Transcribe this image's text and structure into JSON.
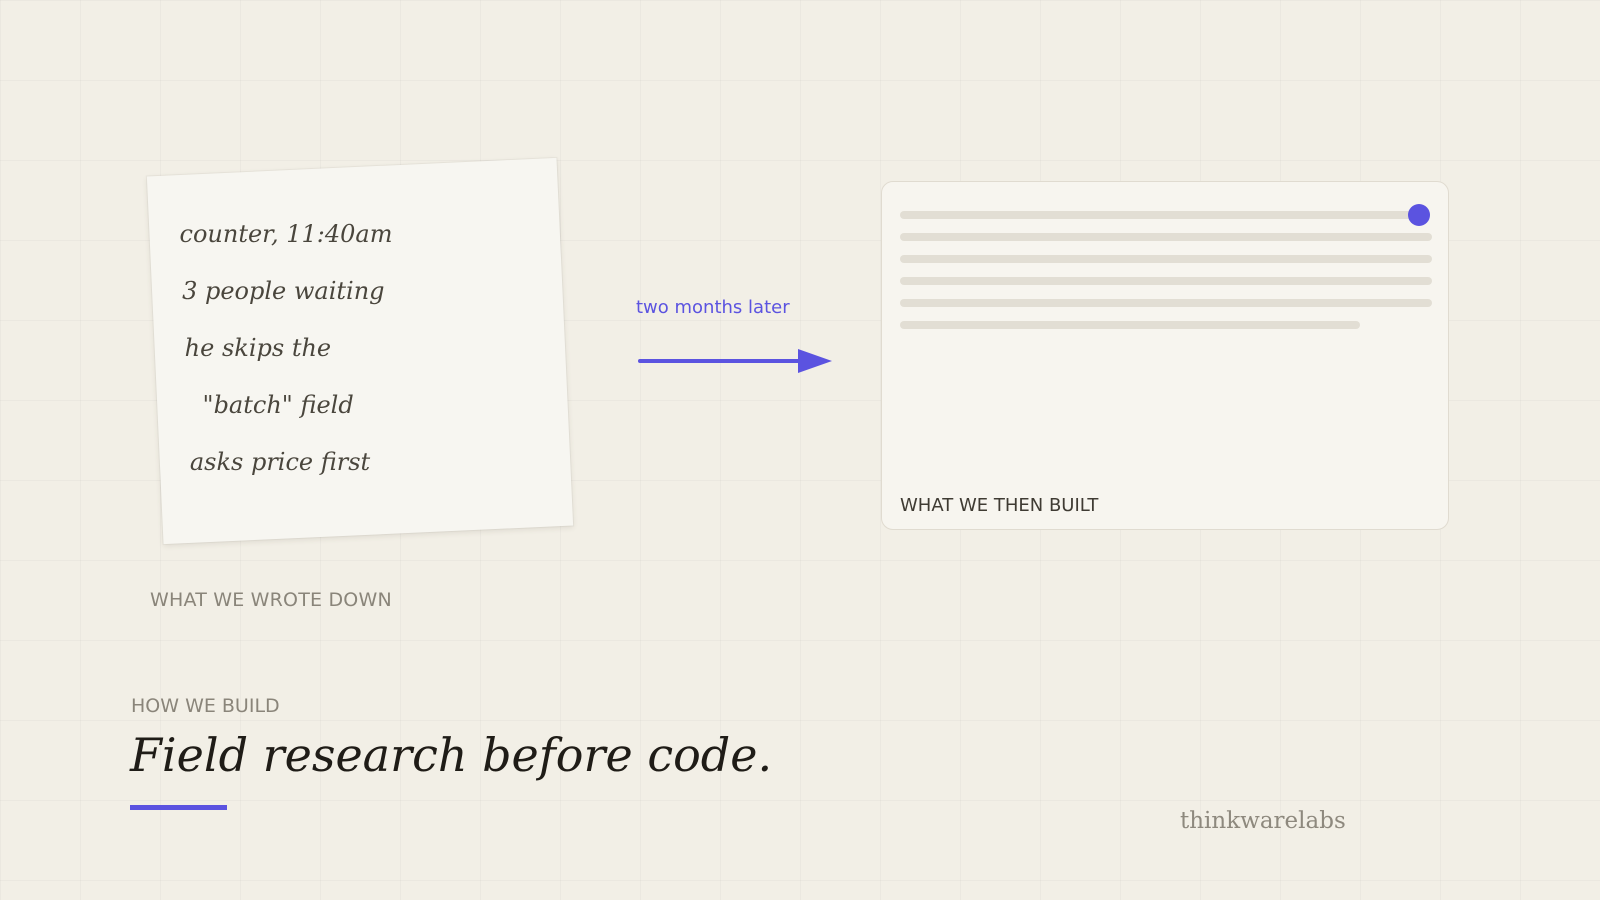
{
  "note": {
    "lines": [
      "counter, 11:40am",
      "3 people waiting",
      "he skips the",
      "  \"batch\" field",
      "asks price first"
    ]
  },
  "captions": {
    "wrote_down": "WHAT WE WROTE DOWN",
    "then_built": "WHAT WE THEN BUILT"
  },
  "annotation": "two months later",
  "section": {
    "eyebrow": "HOW WE BUILD",
    "headline": "Field research before code."
  },
  "brand": "thinkwarelabs",
  "colors": {
    "accent": "#5b53e0",
    "background": "#f2efe6",
    "note_paper": "#f7f6f1",
    "card_bg": "#f7f5ef",
    "placeholder_bar": "#e2ded4",
    "text_dark": "#1f1c17",
    "text_muted": "#8a857a"
  }
}
